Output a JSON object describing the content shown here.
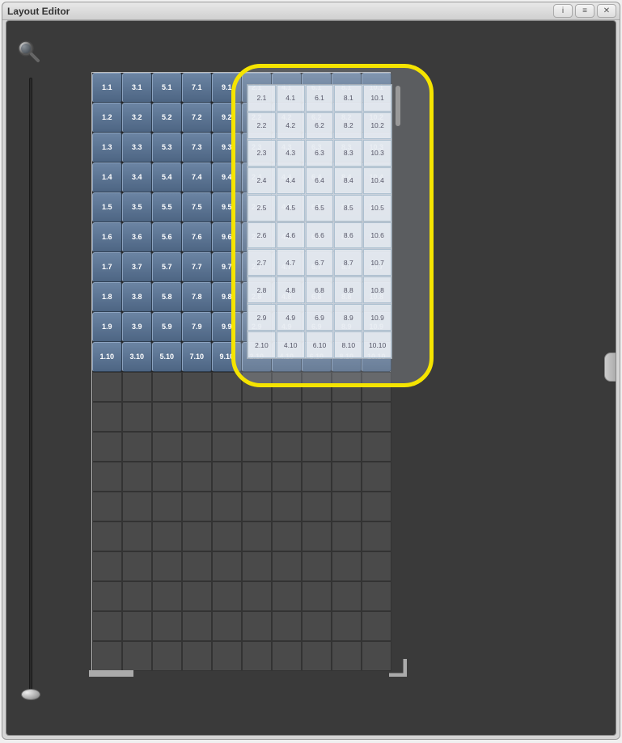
{
  "window": {
    "title": "Layout Editor"
  },
  "titlebar_buttons": {
    "info": "i",
    "menu": "≡",
    "close": "✕"
  },
  "grid": {
    "cols": 10,
    "rows": 20,
    "filled_rows": 10,
    "cells": [
      [
        "1.1",
        "3.1",
        "5.1",
        "7.1",
        "9.1",
        "2.1",
        "4.1",
        "6.1",
        "8.1",
        "10.1"
      ],
      [
        "1.2",
        "3.2",
        "5.2",
        "7.2",
        "9.2",
        "2.2",
        "4.2",
        "6.2",
        "8.2",
        "10.2"
      ],
      [
        "1.3",
        "3.3",
        "5.3",
        "7.3",
        "9.3",
        "2.3",
        "4.3",
        "6.3",
        "8.3",
        "10.3"
      ],
      [
        "1.4",
        "3.4",
        "5.4",
        "7.4",
        "9.4",
        "2.4",
        "4.4",
        "6.4",
        "8.4",
        "10.4"
      ],
      [
        "1.5",
        "3.5",
        "5.5",
        "7.5",
        "9.5",
        "2.5",
        "4.5",
        "6.5",
        "8.5",
        "10.5"
      ],
      [
        "1.6",
        "3.6",
        "5.6",
        "7.6",
        "9.6",
        "2.6",
        "4.6",
        "6.6",
        "8.6",
        "10.6"
      ],
      [
        "1.7",
        "3.7",
        "5.7",
        "7.7",
        "9.7",
        "2.7",
        "4.7",
        "6.7",
        "8.7",
        "10.7"
      ],
      [
        "1.8",
        "3.8",
        "5.8",
        "7.8",
        "9.8",
        "2.8",
        "4.8",
        "6.8",
        "8.8",
        "10.8"
      ],
      [
        "1.9",
        "3.9",
        "5.9",
        "7.9",
        "9.9",
        "2.9",
        "4.9",
        "6.9",
        "8.9",
        "10.9"
      ],
      [
        "1.10",
        "3.10",
        "5.10",
        "7.10",
        "9.10",
        "2.10",
        "4.10",
        "6.10",
        "8.10",
        "10.10"
      ]
    ]
  },
  "preview": {
    "cols": 5,
    "rows": 10,
    "cells": [
      [
        "2.1",
        "4.1",
        "6.1",
        "8.1",
        "10.1"
      ],
      [
        "2.2",
        "4.2",
        "6.2",
        "8.2",
        "10.2"
      ],
      [
        "2.3",
        "4.3",
        "6.3",
        "8.3",
        "10.3"
      ],
      [
        "2.4",
        "4.4",
        "6.4",
        "8.4",
        "10.4"
      ],
      [
        "2.5",
        "4.5",
        "6.5",
        "8.5",
        "10.5"
      ],
      [
        "2.6",
        "4.6",
        "6.6",
        "8.6",
        "10.6"
      ],
      [
        "2.7",
        "4.7",
        "6.7",
        "8.7",
        "10.7"
      ],
      [
        "2.8",
        "4.8",
        "6.8",
        "8.8",
        "10.8"
      ],
      [
        "2.9",
        "4.9",
        "6.9",
        "8.9",
        "10.9"
      ],
      [
        "2.10",
        "4.10",
        "6.10",
        "8.10",
        "10.10"
      ]
    ]
  },
  "colors": {
    "highlight": "#f5e400",
    "cell_blue": "#5a7391",
    "canvas_bg": "#3a3a3a"
  }
}
